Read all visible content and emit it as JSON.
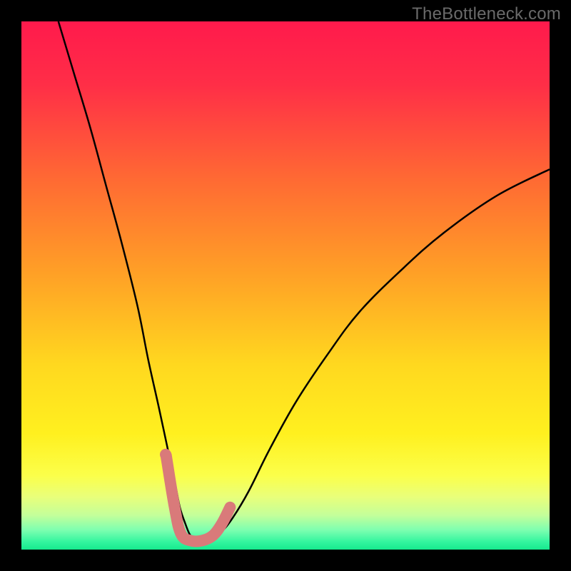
{
  "watermark": "TheBottleneck.com",
  "chart_data": {
    "type": "line",
    "title": "",
    "xlabel": "",
    "ylabel": "",
    "xlim": [
      0,
      100
    ],
    "ylim": [
      0,
      100
    ],
    "background_gradient_stops": [
      {
        "offset": 0.0,
        "color": "#ff1a4c"
      },
      {
        "offset": 0.12,
        "color": "#ff2e47"
      },
      {
        "offset": 0.3,
        "color": "#ff6a33"
      },
      {
        "offset": 0.48,
        "color": "#ffa126"
      },
      {
        "offset": 0.65,
        "color": "#ffd81f"
      },
      {
        "offset": 0.78,
        "color": "#fff01f"
      },
      {
        "offset": 0.86,
        "color": "#fbff4a"
      },
      {
        "offset": 0.9,
        "color": "#e9ff7a"
      },
      {
        "offset": 0.935,
        "color": "#c4ff9a"
      },
      {
        "offset": 0.963,
        "color": "#7dffb0"
      },
      {
        "offset": 0.985,
        "color": "#34f59f"
      },
      {
        "offset": 1.0,
        "color": "#16e98e"
      }
    ],
    "series": [
      {
        "name": "bottleneck-curve",
        "stroke": "#000000",
        "stroke_width": 2.5,
        "x": [
          7,
          10,
          13,
          16,
          19,
          22,
          24,
          26,
          27.5,
          29,
          30,
          31,
          31.8,
          32.6,
          33.3,
          34.5,
          36,
          38,
          40,
          43,
          47,
          52,
          58,
          64,
          72,
          80,
          90,
          100
        ],
        "y": [
          100,
          90,
          80,
          69,
          58,
          46,
          36,
          27,
          20,
          13,
          8,
          5,
          3,
          2,
          1.5,
          1.5,
          2,
          3.5,
          6,
          11,
          19,
          28,
          37,
          45,
          53,
          60,
          67,
          72
        ]
      },
      {
        "name": "highlight-band",
        "stroke": "#d97a7a",
        "stroke_width": 16,
        "linecap": "round",
        "x": [
          27.4,
          29.0,
          30.2,
          32.0,
          34.2,
          36.3,
          38.0,
          39.5
        ],
        "y": [
          17.8,
          8.0,
          3.0,
          1.7,
          1.7,
          2.7,
          5.0,
          8.0
        ]
      }
    ],
    "points": [
      {
        "name": "marker-dot",
        "x": 27.3,
        "y": 18.0,
        "r": 8,
        "fill": "#d97a7a"
      }
    ]
  }
}
